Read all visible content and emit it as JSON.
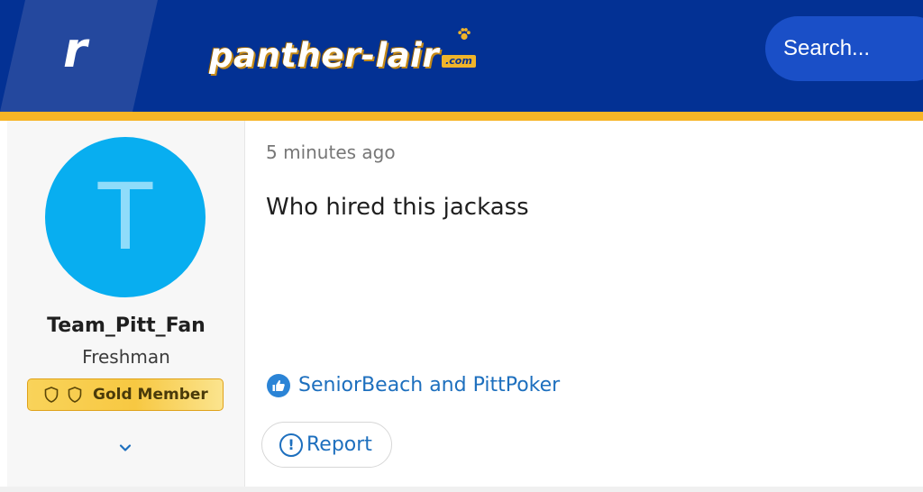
{
  "header": {
    "logo_letter": "r",
    "brand_name": "panther-lair",
    "brand_tld": ".com",
    "search_placeholder": "Search...",
    "colors": {
      "background": "#033194",
      "accent": "#f7b526"
    }
  },
  "author": {
    "avatar_letter": "T",
    "avatar_color": "#08aef0",
    "username": "Team_Pitt_Fan",
    "rank": "Freshman",
    "badge_label": "Gold Member",
    "icons": {
      "expand": "chevron-down-icon"
    }
  },
  "post": {
    "timestamp": "5 minutes ago",
    "text": "Who hired this jackass",
    "likes_text": "SeniorBeach and PittPoker",
    "report_label": "Report",
    "icons": {
      "like": "thumbs-up-icon",
      "report": "alert-circle-icon"
    },
    "link_color": "#1d6fbe"
  }
}
